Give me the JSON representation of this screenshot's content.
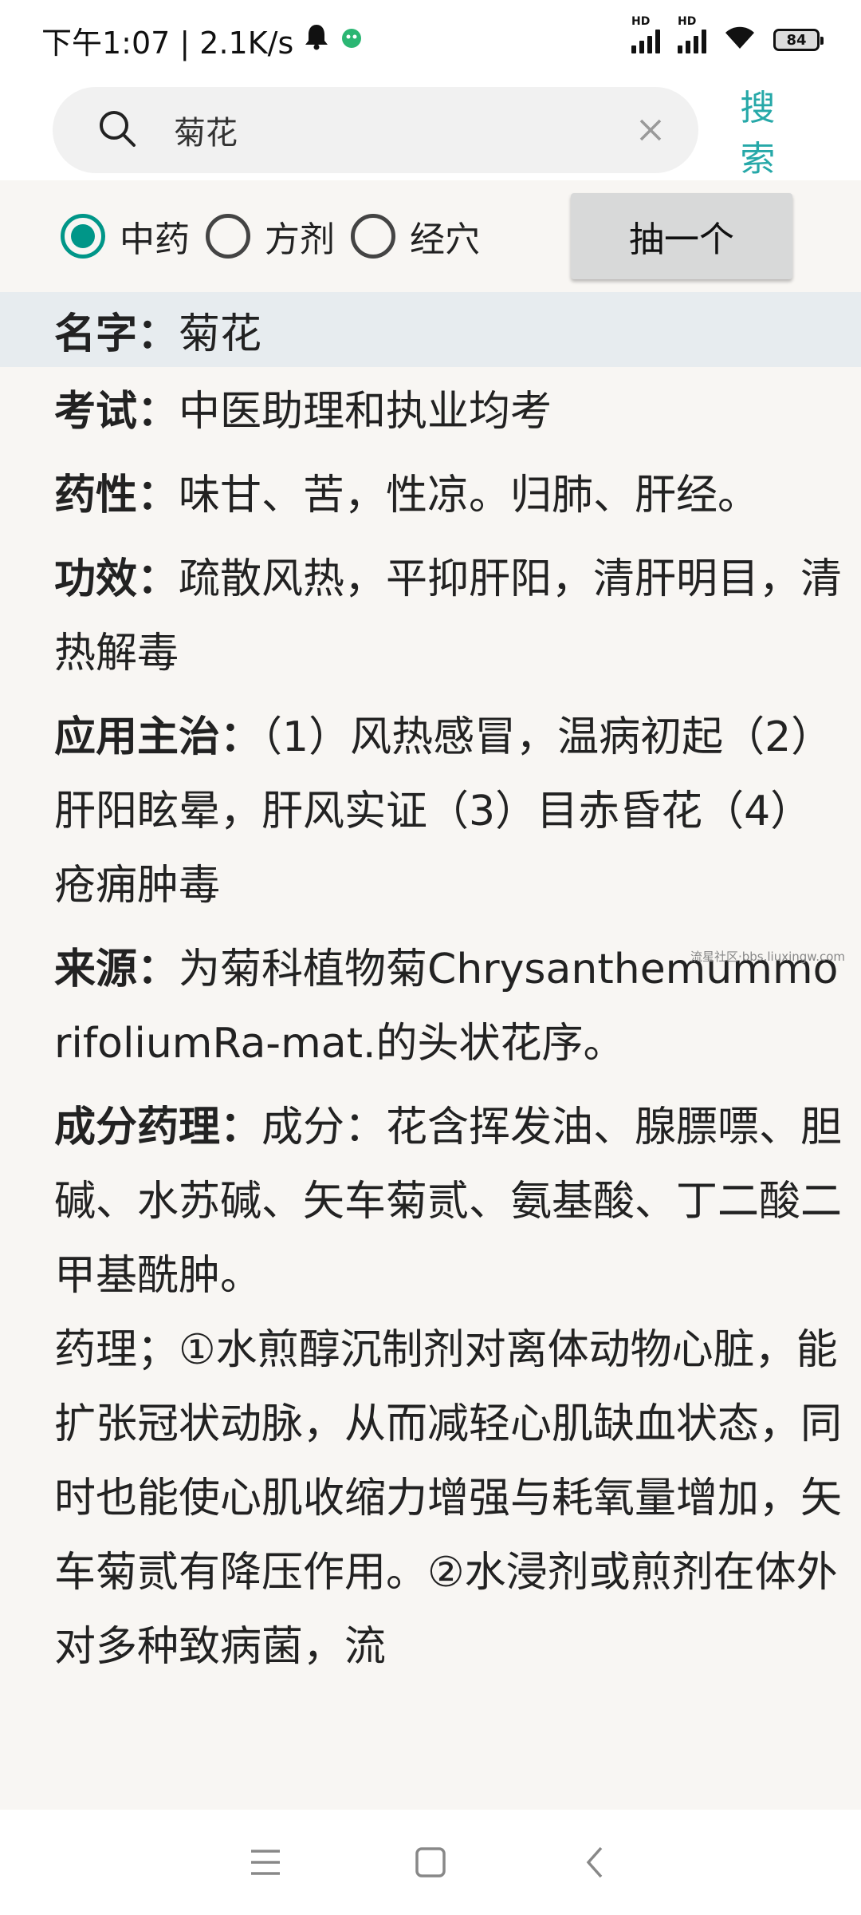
{
  "status_bar": {
    "time": "下午1:07 | 2.1K/s",
    "battery": "84"
  },
  "search": {
    "value": "菊花",
    "action_label": "搜索"
  },
  "options": {
    "items": [
      {
        "label": "中药",
        "checked": true
      },
      {
        "label": "方剂",
        "checked": false
      },
      {
        "label": "经穴",
        "checked": false
      }
    ],
    "draw_label": "抽一个"
  },
  "entry": {
    "name_key": "名字：",
    "name_value": "菊花",
    "exam_key": "考试：",
    "exam_value": "中医助理和执业均考",
    "nature_key": "药性：",
    "nature_value": "味甘、苦，性凉。归肺、肝经。",
    "effect_key": "功效：",
    "effect_value": "疏散风热，平抑肝阳，清肝明目，清热解毒",
    "indication_key": "应用主治：",
    "indication_value": "（1）风热感冒，温病初起（2）肝阳眩晕，肝风实证（3）目赤昏花（4）疮痈肿毒",
    "source_key": "来源：",
    "source_value": "为菊科植物菊ChrysanthemummorifoliumRa-mat.的头状花序。",
    "pharm_key": "成分药理：",
    "pharm_value": "成分：花含挥发油、腺膘嘌、胆碱、水苏碱、矢车菊贰、氨基酸、丁二酸二甲基酰肿。",
    "pharm_text2": "药理；①水煎醇沉制剂对离体动物心脏，能扩张冠状动脉，从而减轻心肌缺血状态，同时也能使心肌收缩力增强与耗氧量增加，矢车菊贰有降压作用。②水浸剂或煎剂在体外对多种致病菌，流"
  },
  "watermark": "流星社区·bbs.liuxingw.com"
}
